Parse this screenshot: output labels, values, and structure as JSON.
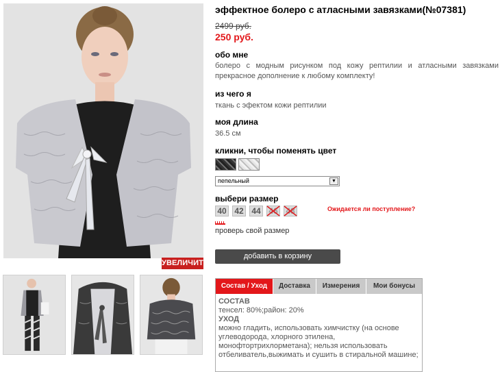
{
  "product": {
    "title": "эффектное болеро с атласными завязками(№07381)",
    "old_price": "2499 руб.",
    "new_price": "250 руб."
  },
  "sections": {
    "about_label": "обо мне",
    "about_text": "болеро с модным рисунком под кожу рептилии и атласными завязками прекрасное дополнение к любому комплекту!",
    "material_label": "из чего я",
    "material_text": "ткань с эфектом кожи рептилии",
    "length_label": "моя длина",
    "length_text": "36.5 см",
    "color_label": "кликни, чтобы поменять цвет",
    "size_label": "выбери размер"
  },
  "color_select": {
    "selected": "пепельный"
  },
  "sizes": [
    {
      "label": "40",
      "available": true
    },
    {
      "label": "42",
      "available": true
    },
    {
      "label": "44",
      "available": true
    },
    {
      "label": "46",
      "available": false
    },
    {
      "label": "48",
      "available": false
    }
  ],
  "notify_link": "Ожидается ли поступление?",
  "check_size_link": "проверь свой размер",
  "cart_button": "добавить в корзину",
  "zoom_button": "УВЕЛИЧИТЬ",
  "tabs": [
    {
      "label": "Состав / Уход",
      "active": true
    },
    {
      "label": "Доставка",
      "active": false
    },
    {
      "label": "Измерения",
      "active": false
    },
    {
      "label": "Мои бонусы",
      "active": false
    }
  ],
  "tab_content": {
    "composition_heading": "СОСТАВ",
    "composition_text": "тенсел: 80%;район: 20%",
    "care_heading": "УХОД",
    "care_text": "можно гладить, использовать химчистку (на основе углеводорода, хлорного этилена, монофтортрихлорметана); нельзя использовать отбеливатель,выжимать и сушить в стиральной машине;"
  },
  "colors": {
    "accent": "#e3171a",
    "cart_button": "#4a4a4a",
    "tab_inactive": "#c9c9c9"
  }
}
